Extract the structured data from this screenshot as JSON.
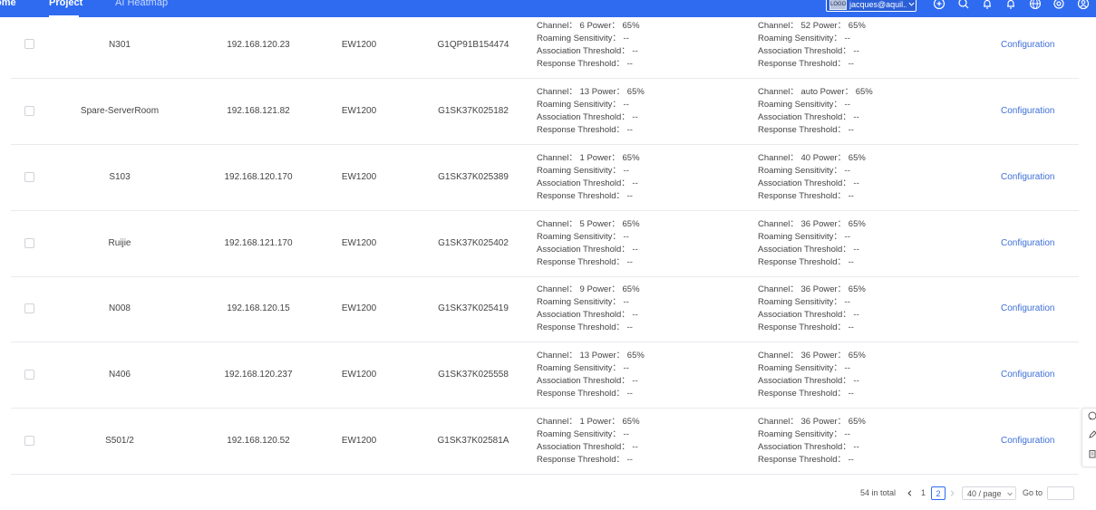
{
  "topbar": {
    "nav": [
      "ome",
      "Project",
      "AI Heatmap"
    ],
    "account_logo": "LOGO",
    "account_email": "jacques@aquil..."
  },
  "rows": [
    {
      "name": "N301",
      "ip": "192.168.120.23",
      "model": "EW1200",
      "sn": "G1QP91B154474",
      "r1": [
        "Channel： 6      Power： 65%",
        "Roaming Sensitivity： --",
        "Association Threshold： --",
        "Response Threshold： --"
      ],
      "r2": [
        "Channel： 52      Power： 65%",
        "Roaming Sensitivity： --",
        "Association Threshold： --",
        "Response Threshold： --"
      ],
      "action": "Configuration"
    },
    {
      "name": "Spare-ServerRoom",
      "ip": "192.168.121.82",
      "model": "EW1200",
      "sn": "G1SK37K025182",
      "r1": [
        "Channel： 13      Power： 65%",
        "Roaming Sensitivity： --",
        "Association Threshold： --",
        "Response Threshold： --"
      ],
      "r2": [
        "Channel： auto    Power： 65%",
        "Roaming Sensitivity： --",
        "Association Threshold： --",
        "Response Threshold： --"
      ],
      "action": "Configuration"
    },
    {
      "name": "S103",
      "ip": "192.168.120.170",
      "model": "EW1200",
      "sn": "G1SK37K025389",
      "r1": [
        "Channel： 1        Power： 65%",
        "Roaming Sensitivity： --",
        "Association Threshold： --",
        "Response Threshold： --"
      ],
      "r2": [
        "Channel： 40      Power： 65%",
        "Roaming Sensitivity： --",
        "Association Threshold： --",
        "Response Threshold： --"
      ],
      "action": "Configuration"
    },
    {
      "name": "Ruijie",
      "ip": "192.168.121.170",
      "model": "EW1200",
      "sn": "G1SK37K025402",
      "r1": [
        "Channel： 5        Power： 65%",
        "Roaming Sensitivity： --",
        "Association Threshold： --",
        "Response Threshold： --"
      ],
      "r2": [
        "Channel： 36      Power： 65%",
        "Roaming Sensitivity： --",
        "Association Threshold： --",
        "Response Threshold： --"
      ],
      "action": "Configuration"
    },
    {
      "name": "N008",
      "ip": "192.168.120.15",
      "model": "EW1200",
      "sn": "G1SK37K025419",
      "r1": [
        "Channel： 9        Power： 65%",
        "Roaming Sensitivity： --",
        "Association Threshold： --",
        "Response Threshold： --"
      ],
      "r2": [
        "Channel： 36      Power： 65%",
        "Roaming Sensitivity： --",
        "Association Threshold： --",
        "Response Threshold： --"
      ],
      "action": "Configuration"
    },
    {
      "name": "N406",
      "ip": "192.168.120.237",
      "model": "EW1200",
      "sn": "G1SK37K025558",
      "r1": [
        "Channel： 13      Power： 65%",
        "Roaming Sensitivity： --",
        "Association Threshold： --",
        "Response Threshold： --"
      ],
      "r2": [
        "Channel： 36      Power： 65%",
        "Roaming Sensitivity： --",
        "Association Threshold： --",
        "Response Threshold： --"
      ],
      "action": "Configuration"
    },
    {
      "name": "S501/2",
      "ip": "192.168.120.52",
      "model": "EW1200",
      "sn": "G1SK37K02581A",
      "r1": [
        "Channel： 1        Power： 65%",
        "Roaming Sensitivity： --",
        "Association Threshold： --",
        "Response Threshold： --"
      ],
      "r2": [
        "Channel： 36      Power： 65%",
        "Roaming Sensitivity： --",
        "Association Threshold： --",
        "Response Threshold： --"
      ],
      "action": "Configuration"
    }
  ],
  "pagination": {
    "total": "54 in total",
    "pages": [
      "1",
      "2"
    ],
    "current_page": "2",
    "page_size": "40 / page",
    "goto_label": "Go to",
    "goto_value": ""
  },
  "colors": {
    "topbar": "#2f6bf0",
    "link": "#3d6fd8",
    "text": "#444444",
    "border": "#e8eaee"
  }
}
